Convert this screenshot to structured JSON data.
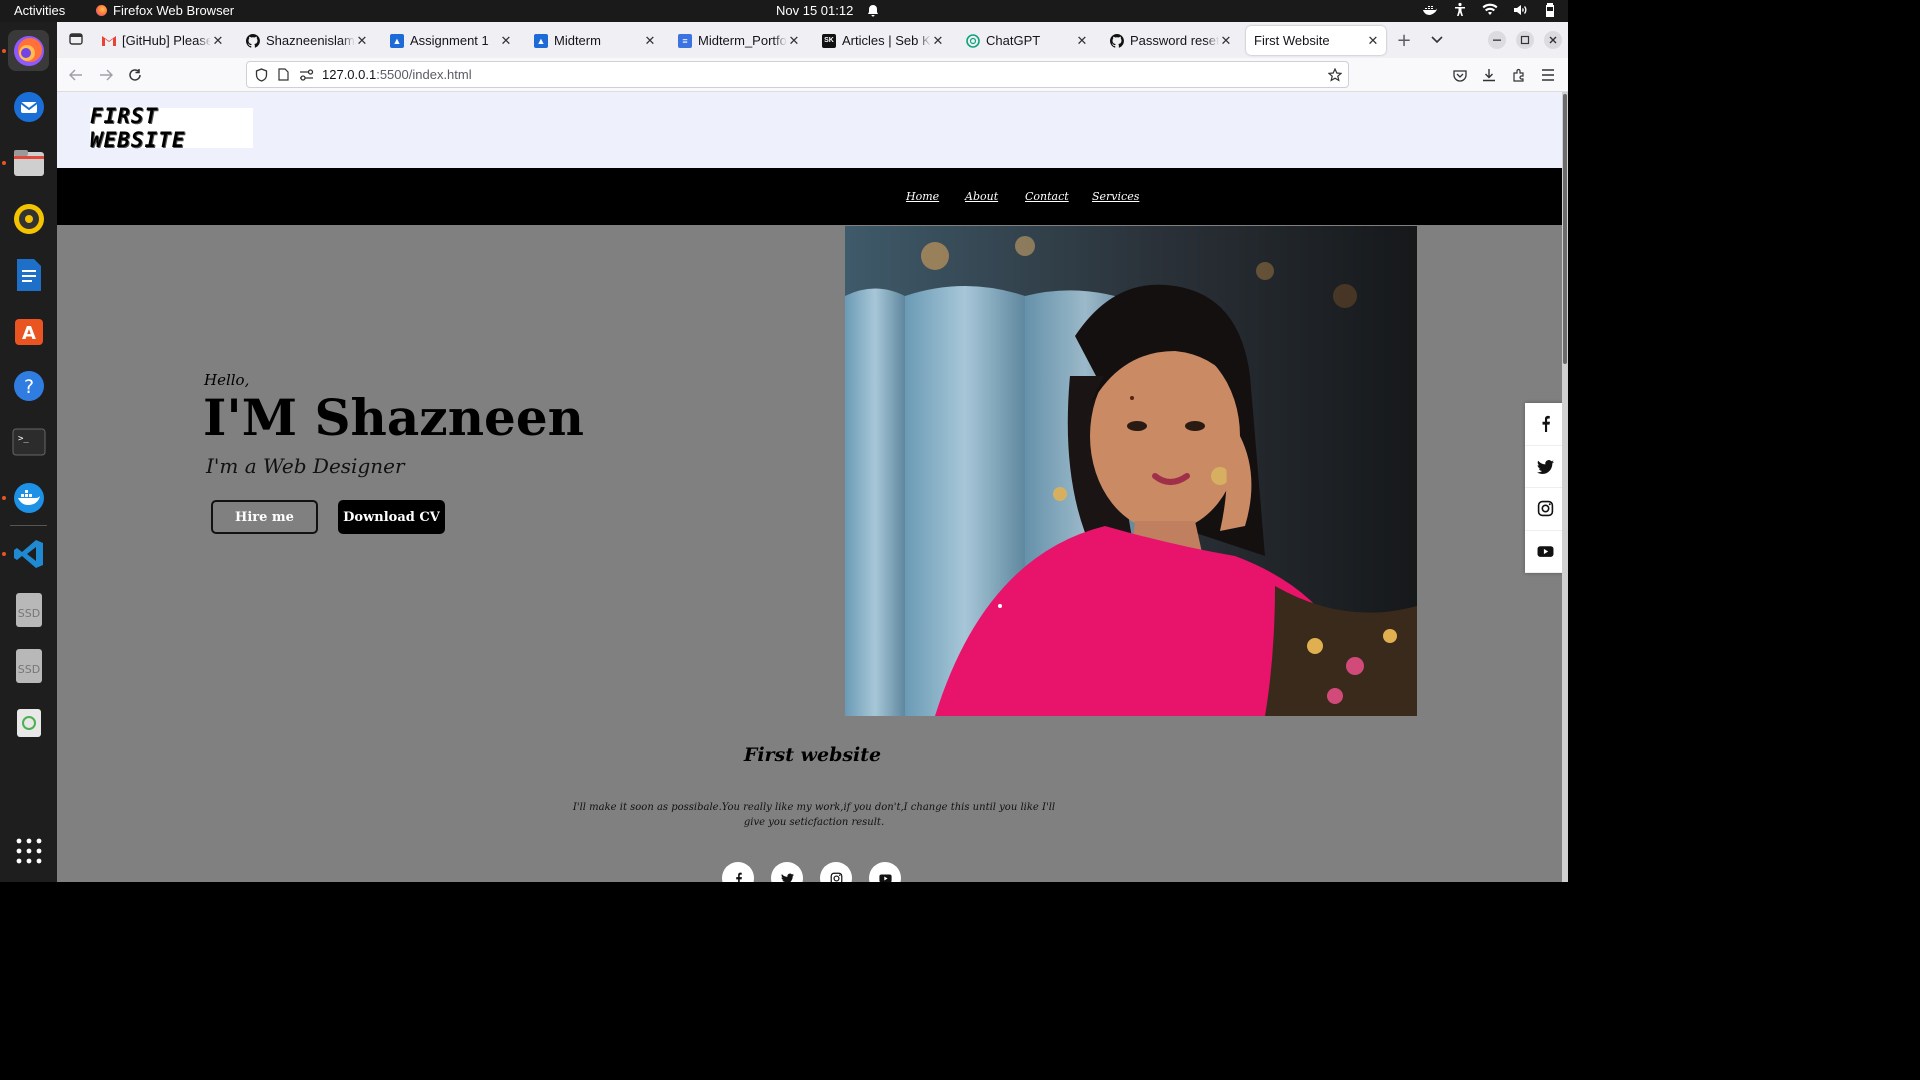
{
  "system": {
    "activities": "Activities",
    "app_name": "Firefox Web Browser",
    "clock": "Nov 15  01:12"
  },
  "dock": {
    "items": [
      "firefox-icon",
      "thunderbird-icon",
      "files-icon",
      "rhythmbox-icon",
      "writer-icon",
      "app-center-icon",
      "help-icon",
      "terminal-icon",
      "docker-icon",
      "vscode-icon",
      "ssd-drive-icon",
      "ssd-drive-icon",
      "trash-icon",
      "show-apps-icon"
    ]
  },
  "tabs": [
    {
      "title": "[GitHub] Please re",
      "icon": "gmail-icon"
    },
    {
      "title": "Shazneenislam/po",
      "icon": "github-icon"
    },
    {
      "title": "Assignment 1",
      "icon": "classroom-icon"
    },
    {
      "title": "Midterm",
      "icon": "classroom-icon"
    },
    {
      "title": "Midterm_Portfolio",
      "icon": "docs-icon"
    },
    {
      "title": "Articles | Seb Kay",
      "icon": "sk-icon"
    },
    {
      "title": "ChatGPT",
      "icon": "chatgpt-icon"
    },
    {
      "title": "Password reset se",
      "icon": "github-icon"
    },
    {
      "title": "First Website",
      "icon": "none",
      "selected": true
    }
  ],
  "url": {
    "host": "127.0.0.1",
    "path": ":5500/index.html"
  },
  "site": {
    "logo_text": "FIRST WEBSITE",
    "nav": [
      "Home",
      "About",
      "Contact",
      "Services"
    ],
    "hero": {
      "hello": "Hello,",
      "name": "I'M Shazneen",
      "role": "I'm a Web Designer",
      "hire_label": "Hire me",
      "cv_label": "Download CV"
    },
    "section_title": "First website",
    "section_text": "I'll make it soon as possibale.You really like my work,if you don't,I change this until you like I'll give you seticfaction result.",
    "social": [
      "facebook-icon",
      "twitter-icon",
      "instagram-icon",
      "youtube-icon"
    ]
  },
  "colors": {
    "page_bg": "#808080",
    "header_bg": "#eef0fb",
    "nav_bg": "#000000",
    "scarf": "#e8136a"
  }
}
